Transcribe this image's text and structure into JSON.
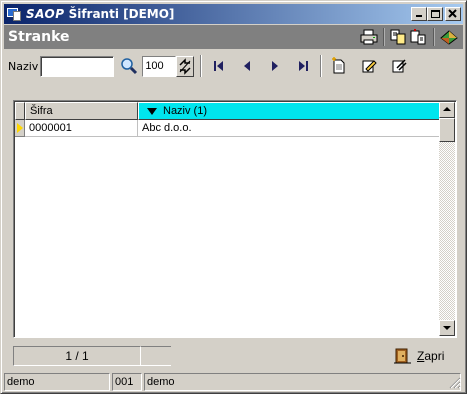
{
  "window": {
    "brand": "SAOP",
    "title": "Šifranti [DEMO]"
  },
  "header": {
    "title": "Stranke",
    "icons": [
      "printer-icon",
      "copy-record-icon",
      "paste-record-icon",
      "export-icon"
    ]
  },
  "toolbar": {
    "filter_label": "Naziv",
    "filter_value": "",
    "limit_value": "100",
    "nav_icons": [
      "first-record-icon",
      "prev-record-icon",
      "next-record-icon",
      "last-record-icon"
    ],
    "edit_icons": [
      "new-record-icon",
      "edit-record-icon",
      "delete-record-icon"
    ]
  },
  "grid": {
    "columns": [
      {
        "label": "Šifra",
        "sorted": false
      },
      {
        "label": "Naziv (1)",
        "sorted": true
      }
    ],
    "rows": [
      {
        "sifra": "0000001",
        "naziv": "Abc d.o.o."
      }
    ],
    "highlight_color": "#00e5ee"
  },
  "footer": {
    "record_position": "1 / 1",
    "close_label_first": "Z",
    "close_label_rest": "apri"
  },
  "statusbar": {
    "user": "demo",
    "company_code": "001",
    "company_name": "demo"
  }
}
